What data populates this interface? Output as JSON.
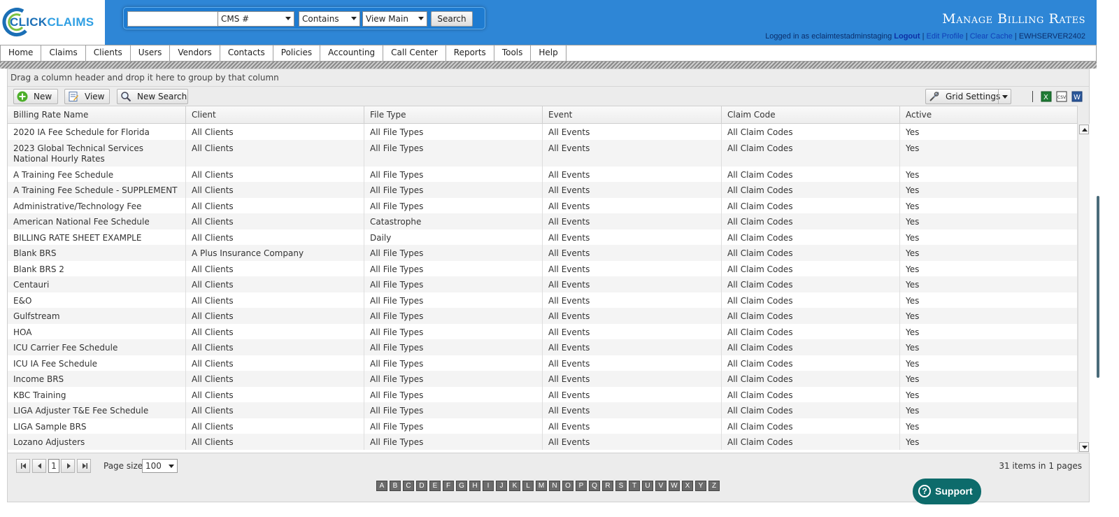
{
  "header": {
    "logo_part1": "CLICK",
    "logo_part2": "CLAIMS",
    "search": {
      "value": "",
      "field": "CMS #",
      "operator": "Contains",
      "view": "View Main",
      "button": "Search"
    },
    "title": "Manage Billing Rates",
    "user": {
      "prefix": "Logged in as eclaimtestadminstaging",
      "logout": "Logout",
      "sep": "|",
      "edit_profile": "Edit Profile",
      "clear_cache": "Clear Cache",
      "server": "EWHSERVER2402"
    }
  },
  "nav": [
    "Home",
    "Claims",
    "Clients",
    "Users",
    "Vendors",
    "Contacts",
    "Policies",
    "Accounting",
    "Call Center",
    "Reports",
    "Tools",
    "Help"
  ],
  "grid": {
    "group_hint": "Drag a column header and drop it here to group by that column",
    "toolbar": {
      "new": "New",
      "view": "View",
      "new_search": "New Search",
      "grid_settings": "Grid Settings"
    },
    "columns": [
      "Billing Rate Name",
      "Client",
      "File Type",
      "Event",
      "Claim Code",
      "Active"
    ],
    "rows": [
      [
        "2020 IA Fee Schedule for Florida",
        "All Clients",
        "All File Types",
        "All Events",
        "All Claim Codes",
        "Yes"
      ],
      [
        "2023 Global Technical Services National Hourly Rates",
        "All Clients",
        "All File Types",
        "All Events",
        "All Claim Codes",
        "Yes"
      ],
      [
        "A Training Fee Schedule",
        "All Clients",
        "All File Types",
        "All Events",
        "All Claim Codes",
        "Yes"
      ],
      [
        "A Training Fee Schedule - SUPPLEMENT",
        "All Clients",
        "All File Types",
        "All Events",
        "All Claim Codes",
        "Yes"
      ],
      [
        "Administrative/Technology Fee",
        "All Clients",
        "All File Types",
        "All Events",
        "All Claim Codes",
        "Yes"
      ],
      [
        "American National Fee Schedule",
        "All Clients",
        "Catastrophe",
        "All Events",
        "All Claim Codes",
        "Yes"
      ],
      [
        "BILLING RATE SHEET EXAMPLE",
        "All Clients",
        "Daily",
        "All Events",
        "All Claim Codes",
        "Yes"
      ],
      [
        "Blank BRS",
        "A Plus Insurance Company",
        "All File Types",
        "All Events",
        "All Claim Codes",
        "Yes"
      ],
      [
        "Blank BRS 2",
        "All Clients",
        "All File Types",
        "All Events",
        "All Claim Codes",
        "Yes"
      ],
      [
        "Centauri",
        "All Clients",
        "All File Types",
        "All Events",
        "All Claim Codes",
        "Yes"
      ],
      [
        "E&O",
        "All Clients",
        "All File Types",
        "All Events",
        "All Claim Codes",
        "Yes"
      ],
      [
        "Gulfstream",
        "All Clients",
        "All File Types",
        "All Events",
        "All Claim Codes",
        "Yes"
      ],
      [
        "HOA",
        "All Clients",
        "All File Types",
        "All Events",
        "All Claim Codes",
        "Yes"
      ],
      [
        "ICU Carrier Fee Schedule",
        "All Clients",
        "All File Types",
        "All Events",
        "All Claim Codes",
        "Yes"
      ],
      [
        "ICU IA Fee Schedule",
        "All Clients",
        "All File Types",
        "All Events",
        "All Claim Codes",
        "Yes"
      ],
      [
        "Income BRS",
        "All Clients",
        "All File Types",
        "All Events",
        "All Claim Codes",
        "Yes"
      ],
      [
        "KBC Training",
        "All Clients",
        "All File Types",
        "All Events",
        "All Claim Codes",
        "Yes"
      ],
      [
        "LIGA Adjuster T&E Fee Schedule",
        "All Clients",
        "All File Types",
        "All Events",
        "All Claim Codes",
        "Yes"
      ],
      [
        "LIGA Sample BRS",
        "All Clients",
        "All File Types",
        "All Events",
        "All Claim Codes",
        "Yes"
      ],
      [
        "Lozano Adjusters",
        "All Clients",
        "All File Types",
        "All Events",
        "All Claim Codes",
        "Yes"
      ]
    ],
    "pager": {
      "current": "1",
      "size_label": "Page size:",
      "size": "100",
      "info": "31 items in 1 pages"
    },
    "alphabet": [
      "A",
      "B",
      "C",
      "D",
      "E",
      "F",
      "G",
      "H",
      "I",
      "J",
      "K",
      "L",
      "M",
      "N",
      "O",
      "P",
      "Q",
      "R",
      "S",
      "T",
      "U",
      "V",
      "W",
      "X",
      "Y",
      "Z"
    ]
  },
  "support": "Support",
  "colors": {
    "header_bg": "#2e86d6",
    "support_bg": "#0d6b6b",
    "link": "#1140b8"
  }
}
